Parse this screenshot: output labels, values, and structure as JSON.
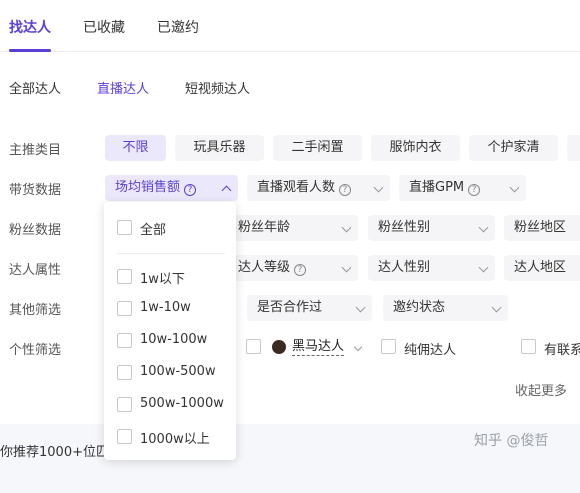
{
  "top_tabs": [
    "找达人",
    "已收藏",
    "已邀约"
  ],
  "sub_tabs": [
    "全部达人",
    "直播达人",
    "短视频达人"
  ],
  "row_labels": {
    "category": "主推类目",
    "sales": "带货数据",
    "fans": "粉丝数据",
    "attrs": "达人属性",
    "other": "其他筛选",
    "personal": "个性筛选"
  },
  "category_pills": [
    "不限",
    "玩具乐器",
    "二手闲置",
    "服饰内衣",
    "个护家清"
  ],
  "sales_dropdowns": [
    "场均销售额",
    "直播观看人数",
    "直播GPM"
  ],
  "fans_dropdowns": [
    "粉丝年龄",
    "粉丝性别",
    "粉丝地区"
  ],
  "attr_dropdowns": [
    "达人等级",
    "达人性别",
    "达人地区"
  ],
  "other_dropdowns": [
    "是否合作过",
    "邀约状态"
  ],
  "personal": {
    "dark_horse": "黑马达人",
    "pure_commission": "纯佣达人",
    "has_contact": "有联系"
  },
  "collapse_label": "收起更多",
  "popup_options": [
    "全部",
    "1w以下",
    "1w-10w",
    "10w-100w",
    "100w-500w",
    "500w-1000w",
    "1000w以上"
  ],
  "bottom_text": "你推荐1000+位匹",
  "watermark": "知乎 @俊哲",
  "colors": {
    "accent": "#5b3fd6"
  }
}
